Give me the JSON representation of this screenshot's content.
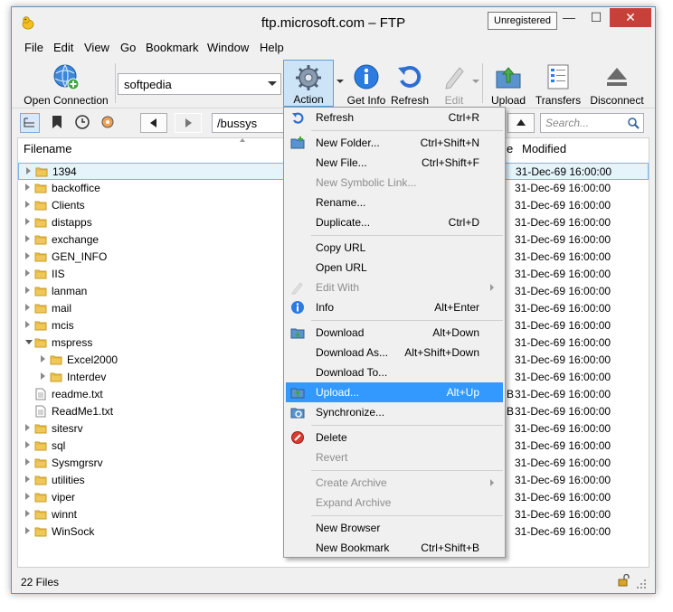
{
  "window": {
    "title": "ftp.microsoft.com – FTP",
    "unregistered": "Unregistered",
    "min": "—",
    "max": "☐",
    "close": "✕"
  },
  "menubar": [
    "File",
    "Edit",
    "View",
    "Go",
    "Bookmark",
    "Window",
    "Help"
  ],
  "toolbar": {
    "open_connection": "Open Connection",
    "server": "softpedia",
    "action": "Action",
    "get_info": "Get Info",
    "refresh": "Refresh",
    "edit": "Edit",
    "upload": "Upload",
    "transfers": "Transfers",
    "disconnect": "Disconnect"
  },
  "navbar": {
    "path": "/bussys",
    "search_placeholder": "Search..."
  },
  "columns": {
    "filename": "Filename",
    "size_tail": "e",
    "modified": "Modified"
  },
  "files": [
    {
      "name": "1394",
      "type": "folder",
      "modified": "31-Dec-69 16:00:00"
    },
    {
      "name": "backoffice",
      "type": "folder",
      "modified": "31-Dec-69 16:00:00"
    },
    {
      "name": "Clients",
      "type": "folder",
      "modified": "31-Dec-69 16:00:00"
    },
    {
      "name": "distapps",
      "type": "folder",
      "modified": "31-Dec-69 16:00:00"
    },
    {
      "name": "exchange",
      "type": "folder",
      "modified": "31-Dec-69 16:00:00"
    },
    {
      "name": "GEN_INFO",
      "type": "folder",
      "modified": "31-Dec-69 16:00:00"
    },
    {
      "name": "IIS",
      "type": "folder",
      "modified": "31-Dec-69 16:00:00"
    },
    {
      "name": "lanman",
      "type": "folder",
      "modified": "31-Dec-69 16:00:00"
    },
    {
      "name": "mail",
      "type": "folder",
      "modified": "31-Dec-69 16:00:00"
    },
    {
      "name": "mcis",
      "type": "folder",
      "modified": "31-Dec-69 16:00:00"
    },
    {
      "name": "mspress",
      "type": "folder-open",
      "modified": "31-Dec-69 16:00:00"
    },
    {
      "name": "Excel2000",
      "type": "subfolder",
      "modified": "31-Dec-69 16:00:00"
    },
    {
      "name": "Interdev",
      "type": "subfolder",
      "modified": "31-Dec-69 16:00:00"
    },
    {
      "name": "readme.txt",
      "type": "file",
      "size": "B",
      "modified": "31-Dec-69 16:00:00"
    },
    {
      "name": "ReadMe1.txt",
      "type": "file",
      "size": "B",
      "modified": "31-Dec-69 16:00:00"
    },
    {
      "name": "sitesrv",
      "type": "folder",
      "modified": "31-Dec-69 16:00:00"
    },
    {
      "name": "sql",
      "type": "folder",
      "modified": "31-Dec-69 16:00:00"
    },
    {
      "name": "Sysmgrsrv",
      "type": "folder",
      "modified": "31-Dec-69 16:00:00"
    },
    {
      "name": "utilities",
      "type": "folder",
      "modified": "31-Dec-69 16:00:00"
    },
    {
      "name": "viper",
      "type": "folder",
      "modified": "31-Dec-69 16:00:00"
    },
    {
      "name": "winnt",
      "type": "folder",
      "modified": "31-Dec-69 16:00:00"
    },
    {
      "name": "WinSock",
      "type": "folder",
      "modified": "31-Dec-69 16:00:00"
    }
  ],
  "status": "22 Files",
  "context_menu": [
    {
      "label": "Refresh",
      "shortcut": "Ctrl+R",
      "icon": "refresh-icon"
    },
    {
      "sep": true
    },
    {
      "label": "New Folder...",
      "shortcut": "Ctrl+Shift+N",
      "icon": "new-folder-icon"
    },
    {
      "label": "New File...",
      "shortcut": "Ctrl+Shift+F"
    },
    {
      "label": "New Symbolic Link...",
      "disabled": true
    },
    {
      "label": "Rename..."
    },
    {
      "label": "Duplicate...",
      "shortcut": "Ctrl+D"
    },
    {
      "sep": true
    },
    {
      "label": "Copy URL"
    },
    {
      "label": "Open URL"
    },
    {
      "label": "Edit With",
      "disabled": true,
      "submenu": true,
      "icon": "pencil-icon"
    },
    {
      "label": "Info",
      "shortcut": "Alt+Enter",
      "icon": "info-icon"
    },
    {
      "sep": true
    },
    {
      "label": "Download",
      "shortcut": "Alt+Down",
      "icon": "download-icon"
    },
    {
      "label": "Download As...",
      "shortcut": "Alt+Shift+Down"
    },
    {
      "label": "Download To..."
    },
    {
      "label": "Upload...",
      "shortcut": "Alt+Up",
      "highlighted": true,
      "icon": "upload-icon"
    },
    {
      "label": "Synchronize...",
      "icon": "sync-icon"
    },
    {
      "sep": true
    },
    {
      "label": "Delete",
      "icon": "delete-icon"
    },
    {
      "label": "Revert",
      "disabled": true
    },
    {
      "sep": true
    },
    {
      "label": "Create Archive",
      "disabled": true,
      "submenu": true
    },
    {
      "label": "Expand Archive",
      "disabled": true
    },
    {
      "sep": true
    },
    {
      "label": "New Browser"
    },
    {
      "label": "New Bookmark",
      "shortcut": "Ctrl+Shift+B"
    }
  ]
}
